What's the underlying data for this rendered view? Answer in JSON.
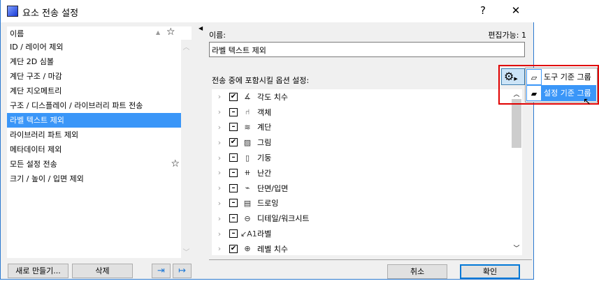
{
  "window": {
    "title": "요소 전송 설정",
    "help": "?",
    "close": "✕"
  },
  "list": {
    "header": "이름",
    "items": [
      {
        "label": "ID / 레이어 제외",
        "star": false
      },
      {
        "label": "계단 2D 심볼",
        "star": false
      },
      {
        "label": "계단 구조 / 마감",
        "star": false
      },
      {
        "label": "계단 지오메트리",
        "star": false
      },
      {
        "label": "구조 / 디스플레이 / 라이브러리 파트 전송",
        "star": false
      },
      {
        "label": "라벨 텍스트 제외",
        "star": false,
        "selected": true
      },
      {
        "label": "라이브러리 파트 제외",
        "star": false
      },
      {
        "label": "메타데이터 제외",
        "star": false
      },
      {
        "label": "모든 설정 전송",
        "star": true
      },
      {
        "label": "크기 / 높이 / 입면 제외",
        "star": false
      }
    ]
  },
  "buttons": {
    "new": "새로 만들기...",
    "delete": "삭제",
    "cancel": "취소",
    "ok": "확인"
  },
  "details": {
    "name_label": "이름:",
    "editable": "편집가능: 1",
    "name_value": "라벨 텍스트 제외",
    "options_label": "전송 중에 포함시킬 옵션 설정:"
  },
  "tree": [
    {
      "label": "각도 치수",
      "state": "checked",
      "icon": "angle-dimension-icon",
      "glyph": "∡"
    },
    {
      "label": "객체",
      "state": "partial",
      "icon": "chair-icon",
      "glyph": "⑁"
    },
    {
      "label": "계단",
      "state": "partial",
      "icon": "stair-icon",
      "glyph": "≋"
    },
    {
      "label": "그림",
      "state": "checked",
      "icon": "picture-icon",
      "glyph": "▨"
    },
    {
      "label": "기둥",
      "state": "partial",
      "icon": "column-icon",
      "glyph": "▯"
    },
    {
      "label": "난간",
      "state": "partial",
      "icon": "railing-icon",
      "glyph": "⧺"
    },
    {
      "label": "단면/입면",
      "state": "partial",
      "icon": "section-icon",
      "glyph": "⌁"
    },
    {
      "label": "드로잉",
      "state": "partial",
      "icon": "drawing-icon",
      "glyph": "▤"
    },
    {
      "label": "디테일/워크시트",
      "state": "partial",
      "icon": "detail-icon",
      "glyph": "⊖"
    },
    {
      "label": "라벨",
      "state": "partial",
      "icon": "label-icon",
      "glyph": "↙A1"
    },
    {
      "label": "레벨 치수",
      "state": "checked",
      "icon": "level-dimension-icon",
      "glyph": "⊕"
    }
  ],
  "menu": {
    "items": [
      {
        "label": "도구 기준 그룹"
      },
      {
        "label": "설정 기준 그룹",
        "highlighted": true
      }
    ]
  }
}
